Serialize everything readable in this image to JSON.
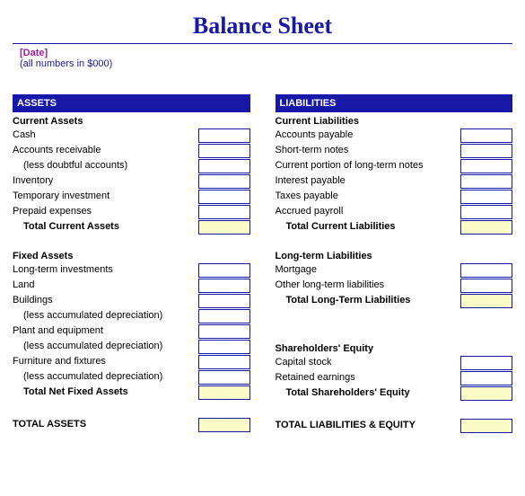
{
  "title": "Balance Sheet",
  "date_placeholder": "[Date]",
  "units_note": "(all numbers in $000)",
  "left": {
    "header": "ASSETS",
    "sec1_title": "Current Assets",
    "sec1_items": {
      "0": "Cash",
      "1": "Accounts receivable",
      "2": "(less doubtful accounts)",
      "3": "Inventory",
      "4": "Temporary investment",
      "5": "Prepaid expenses"
    },
    "sec1_total": "Total Current Assets",
    "sec2_title": "Fixed Assets",
    "sec2_items": {
      "0": "Long-term investments",
      "1": "Land",
      "2": "Buildings",
      "3": "(less accumulated depreciation)",
      "4": "Plant and equipment",
      "5": "(less accumulated depreciation)",
      "6": "Furniture and fixtures",
      "7": "(less accumulated depreciation)"
    },
    "sec2_total": "Total Net Fixed Assets",
    "grand": "TOTAL ASSETS"
  },
  "right": {
    "header": "LIABILITIES",
    "sec1_title": "Current Liabilities",
    "sec1_items": {
      "0": "Accounts payable",
      "1": "Short-term notes",
      "2": "Current portion of long-term notes",
      "3": "Interest payable",
      "4": "Taxes payable",
      "5": "Accrued payroll"
    },
    "sec1_total": "Total Current Liabilities",
    "sec2_title": "Long-term Liabilities",
    "sec2_items": {
      "0": "Mortgage",
      "1": "Other long-term liabilities"
    },
    "sec2_total": "Total Long-Term Liabilities",
    "sec3_title": "Shareholders' Equity",
    "sec3_items": {
      "0": "Capital stock",
      "1": "Retained earnings"
    },
    "sec3_total": "Total Shareholders' Equity",
    "grand": "TOTAL LIABILITIES & EQUITY"
  }
}
